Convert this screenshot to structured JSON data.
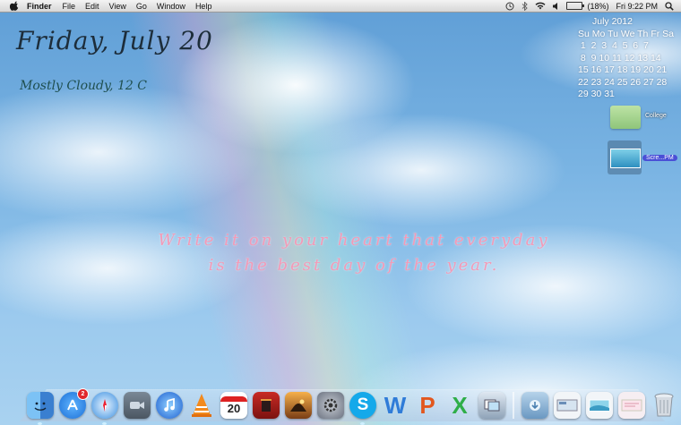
{
  "menubar": {
    "app_name": "Finder",
    "menus": [
      "File",
      "Edit",
      "View",
      "Go",
      "Window",
      "Help"
    ],
    "battery_text": "(18%)",
    "clock": "Fri 9:22 PM"
  },
  "widgets": {
    "date_title": "Friday, July 20",
    "weather": "Mostly Cloudy, 12 C",
    "quote_line1": "Write it on your heart that everyday",
    "quote_line2": "is the best day of the year.",
    "calendar": {
      "title": "July 2012",
      "rows": [
        "Su Mo Tu We Th Fr Sa",
        " 1  2  3  4  5  6  7",
        " 8  9 10 11 12 13 14",
        "15 16 17 18 19 20 21",
        "22 23 24 25 26 27 28",
        "29 30 31"
      ]
    }
  },
  "desktop": {
    "folder_label": "College",
    "screenshot_label": "Scre...PM"
  },
  "dock": {
    "app_store_badge": "2",
    "calendar_day": "20",
    "skype_letter": "S",
    "word_letter": "W",
    "powerpoint_letter": "P",
    "excel_letter": "X",
    "colors": {
      "finder": "#4a8fd8",
      "app_store": "#2d86e6",
      "safari": "#3a8fe0",
      "facetime": "#5c6a78",
      "itunes": "#2a6fd6",
      "vlc": "#f08a1c",
      "ical": "#ffffff",
      "photo_booth": "#b3221e",
      "iphoto": "#3d7ab8",
      "system_prefs": "#8b9098",
      "skype": "#15a9ea",
      "word": "#2f7cd8",
      "powerpoint": "#e2571e",
      "excel": "#2fae48",
      "preview": "#a7b6c8",
      "downloads": "#8fb7d8",
      "trash": "#c5cdd6"
    }
  }
}
